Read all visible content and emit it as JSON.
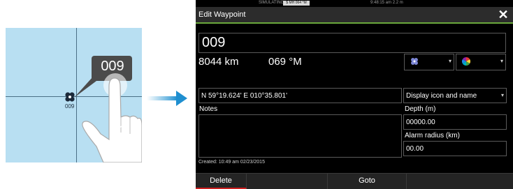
{
  "illustration": {
    "waypoint_label": "009",
    "bubble_text": "009",
    "tap_count": "x1"
  },
  "status_bar": {
    "simulating": "SIMULATING...",
    "badge": "$ MH 064 °M",
    "time": "9:48:15 am  2.2 m"
  },
  "dialog": {
    "title": "Edit Waypoint",
    "name_value": "009",
    "distance": "8044 km",
    "bearing": "069 °M",
    "position": "N 59°19.624'  E 010°35.801'",
    "display_option": "Display icon and name",
    "notes_label": "Notes",
    "notes_value": "",
    "depth_label": "Depth (m)",
    "depth_value": "00000.00",
    "alarm_label": "Alarm radius (km)",
    "alarm_value": "00.00",
    "created": "Created: 10:49 am  02/23/2015",
    "delete_label": "Delete",
    "goto_label": "Goto"
  },
  "colors": {
    "accent_green": "#6aa83c",
    "delete_red": "#cc2020",
    "map_water": "#b8dff2"
  }
}
